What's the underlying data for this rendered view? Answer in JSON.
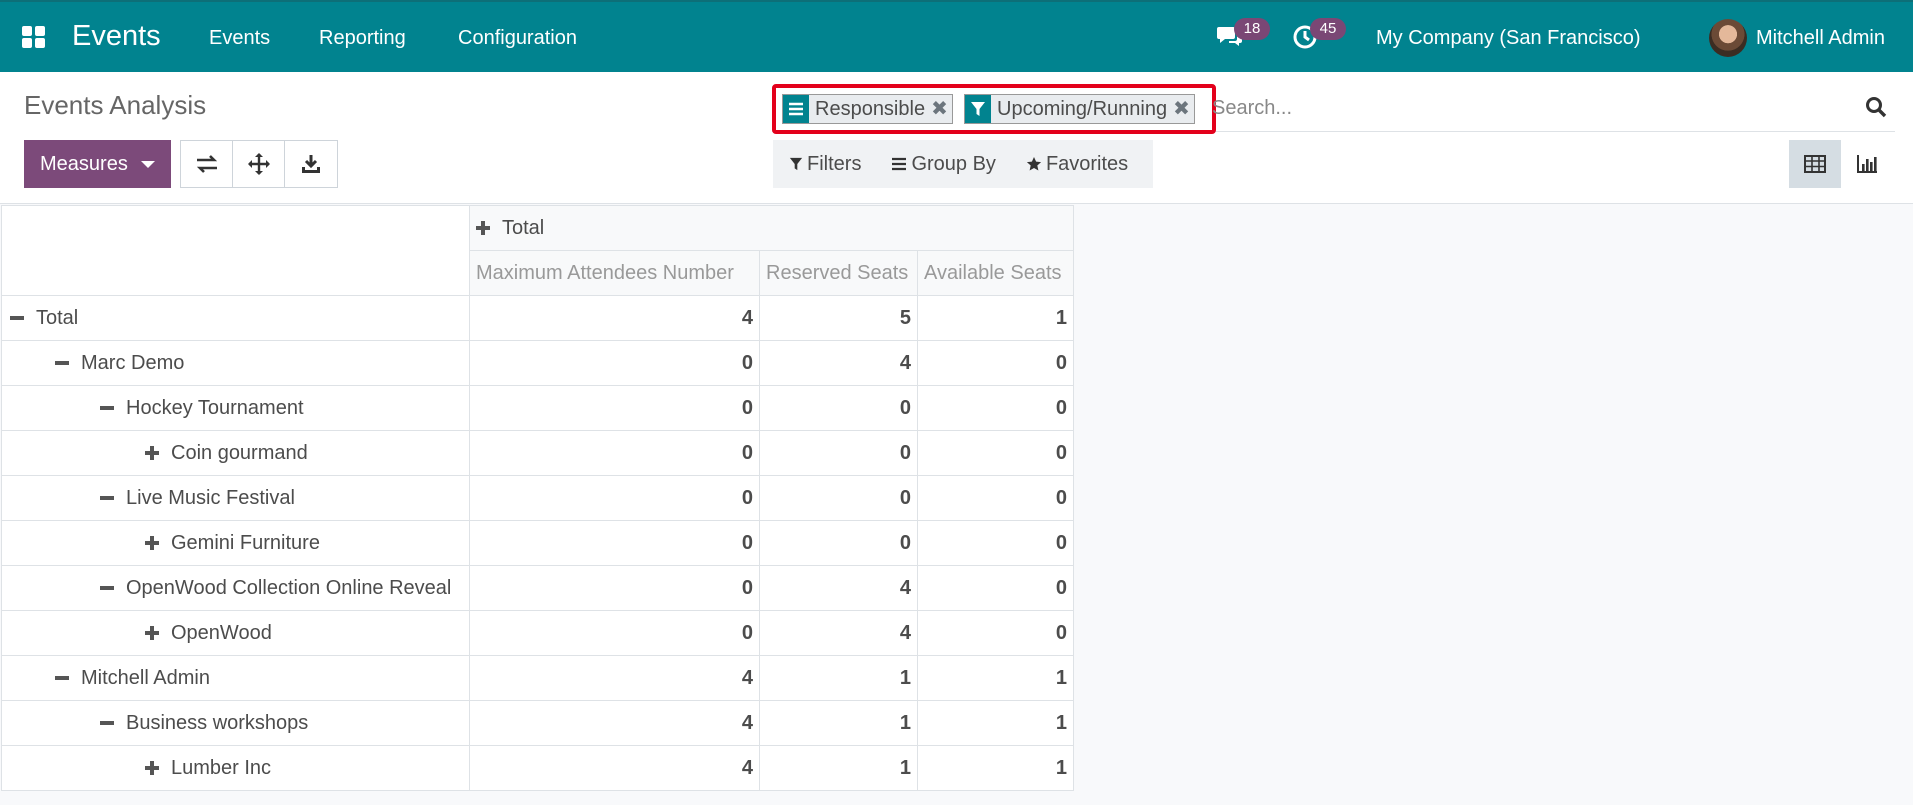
{
  "navbar": {
    "app_name": "Events",
    "menu": [
      "Events",
      "Reporting",
      "Configuration"
    ],
    "messages_count": "18",
    "activities_count": "45",
    "company": "My Company (San Francisco)",
    "user": "Mitchell Admin",
    "bg_color": "#01838f",
    "badge_color": "#7a4775"
  },
  "control": {
    "title": "Events Analysis",
    "measures_label": "Measures",
    "facets": [
      {
        "icon": "group-by-icon",
        "label": "Responsible"
      },
      {
        "icon": "filter-icon",
        "label": "Upcoming/Running"
      }
    ],
    "search_placeholder": "Search...",
    "filters_label": "Filters",
    "groupby_label": "Group By",
    "favorites_label": "Favorites",
    "measures_color": "#7c4a7a"
  },
  "pivot": {
    "col_total": "Total",
    "measures": [
      "Maximum Attendees Number",
      "Reserved Seats",
      "Available Seats"
    ],
    "rows": [
      {
        "label": "Total",
        "level": 0,
        "expanded": true,
        "values": [
          "4",
          "5",
          "1"
        ]
      },
      {
        "label": "Marc Demo",
        "level": 1,
        "expanded": true,
        "values": [
          "0",
          "4",
          "0"
        ]
      },
      {
        "label": "Hockey Tournament",
        "level": 2,
        "expanded": true,
        "values": [
          "0",
          "0",
          "0"
        ]
      },
      {
        "label": "Coin gourmand",
        "level": 3,
        "expanded": false,
        "values": [
          "0",
          "0",
          "0"
        ]
      },
      {
        "label": "Live Music Festival",
        "level": 2,
        "expanded": true,
        "values": [
          "0",
          "0",
          "0"
        ]
      },
      {
        "label": "Gemini Furniture",
        "level": 3,
        "expanded": false,
        "values": [
          "0",
          "0",
          "0"
        ]
      },
      {
        "label": "OpenWood Collection Online Reveal",
        "level": 2,
        "expanded": true,
        "values": [
          "0",
          "4",
          "0"
        ]
      },
      {
        "label": "OpenWood",
        "level": 3,
        "expanded": false,
        "values": [
          "0",
          "4",
          "0"
        ]
      },
      {
        "label": "Mitchell Admin",
        "level": 1,
        "expanded": true,
        "values": [
          "4",
          "1",
          "1"
        ]
      },
      {
        "label": "Business workshops",
        "level": 2,
        "expanded": true,
        "values": [
          "4",
          "1",
          "1"
        ]
      },
      {
        "label": "Lumber Inc",
        "level": 3,
        "expanded": false,
        "values": [
          "4",
          "1",
          "1"
        ]
      }
    ]
  }
}
